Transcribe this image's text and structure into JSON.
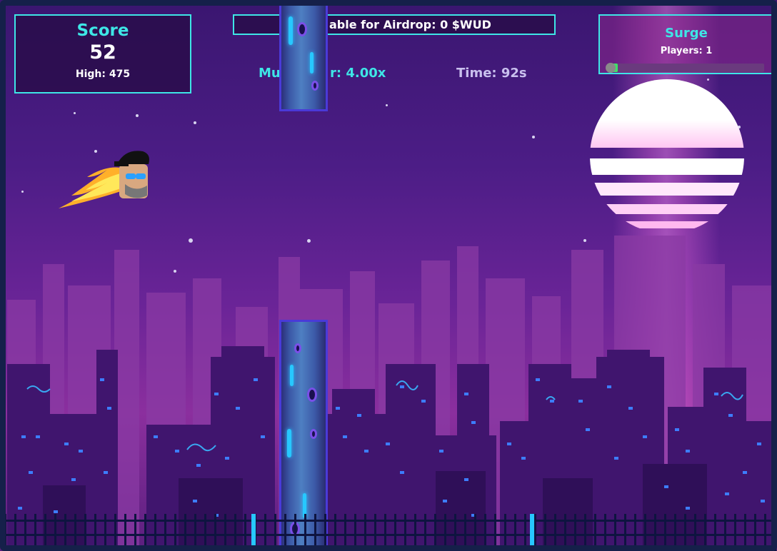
{
  "score_panel": {
    "title": "Score",
    "score": "52",
    "high": "High: 475"
  },
  "airdrop_banner": {
    "text": "able for Airdrop: 0 $WUD"
  },
  "multiplier": {
    "text_left": "Mu",
    "text_right": "r: 4.00x"
  },
  "timer": {
    "text": "Time: 92s"
  },
  "surge_panel": {
    "title": "Surge",
    "players": "Players: 1",
    "progress": 0.06
  },
  "colors": {
    "accent": "#3ee6e6",
    "panel_bg": "#2a0c46",
    "sun": "#ffffff",
    "pipe_glow": "#27c8ff"
  },
  "icons": {
    "player": "flying-character-with-flame",
    "sun": "striped-retro-sun"
  }
}
